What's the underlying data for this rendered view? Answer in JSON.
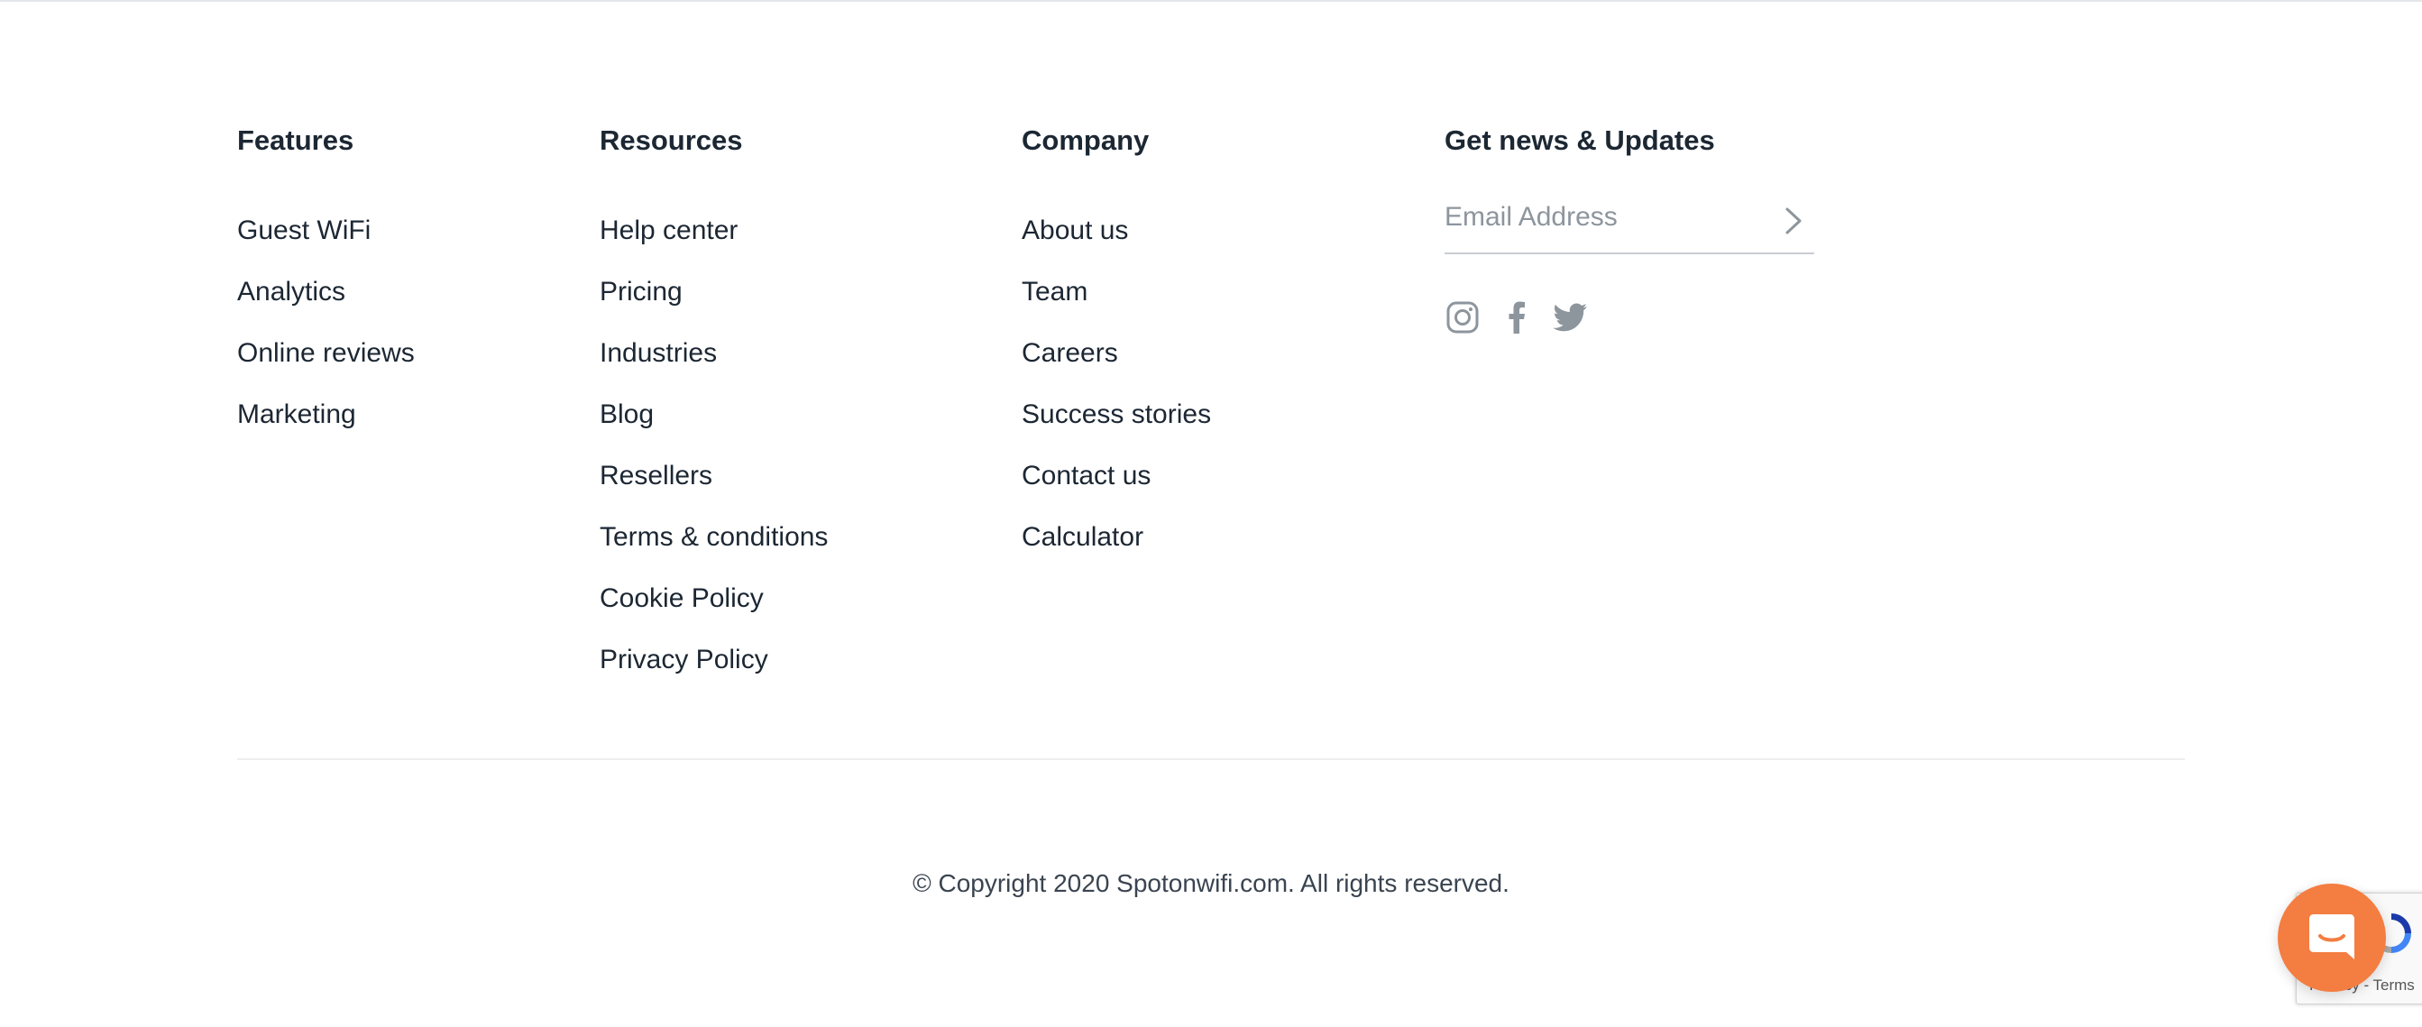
{
  "footer": {
    "columns": [
      {
        "heading": "Features",
        "links": [
          "Guest WiFi",
          "Analytics",
          "Online reviews",
          "Marketing"
        ]
      },
      {
        "heading": "Resources",
        "links": [
          "Help center",
          "Pricing",
          "Industries",
          "Blog",
          "Resellers",
          "Terms & conditions",
          "Cookie Policy",
          "Privacy Policy"
        ]
      },
      {
        "heading": "Company",
        "links": [
          "About us",
          "Team",
          "Careers",
          "Success stories",
          "Contact us",
          "Calculator"
        ]
      }
    ],
    "newsletter": {
      "heading": "Get news & Updates",
      "email_placeholder": "Email Address",
      "submit_icon": "chevron-right-icon"
    },
    "socials": [
      "instagram-icon",
      "facebook-icon",
      "twitter-icon"
    ],
    "copyright": "© Copyright 2020 Spotonwifi.com. All rights reserved."
  },
  "recaptcha": {
    "text": "Privacy - Terms"
  },
  "chat_launcher": {
    "icon": "chat-icon",
    "color": "#f47d41"
  },
  "colors": {
    "text": "#1c2733",
    "muted_icon": "#8d959d",
    "accent": "#f47d41"
  }
}
